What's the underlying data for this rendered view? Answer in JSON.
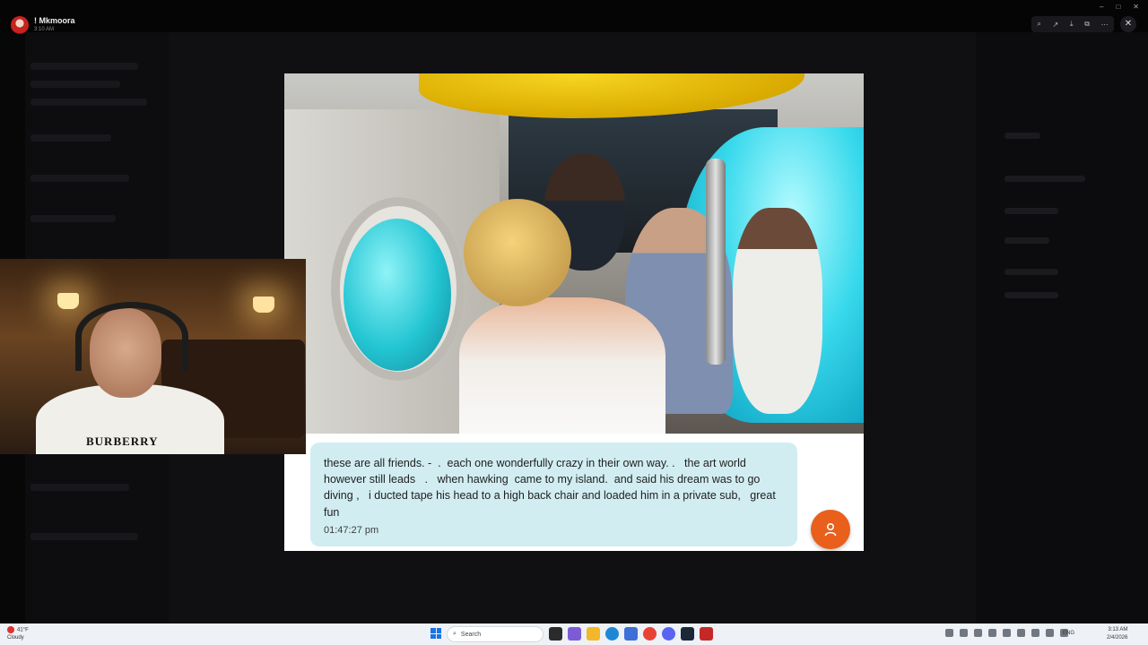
{
  "viewer": {
    "user_name": "! Mkmoora",
    "time": "3:10 AM"
  },
  "window_controls": [
    "–",
    "□",
    "✕"
  ],
  "viewer_tools": [
    "zoom-icon",
    "share-icon",
    "download-icon",
    "open-icon",
    "more-icon"
  ],
  "message": {
    "text": "these are all friends. -  .  each one wonderfully crazy in their own way. .   the art world however still leads   .   when hawking  came to my island.  and said his dream was to go diving ,   i ducted tape his head to a high back chair and loaded him in a private sub,   great fun",
    "timestamp": "01:47:27 pm"
  },
  "webcam": {
    "shirt_logo": "BURBERRY"
  },
  "taskbar": {
    "weather_temp": "41°F",
    "weather_desc": "Cloudy",
    "search_placeholder": "Search",
    "language": "ENG",
    "clock_time": "3:13 AM",
    "clock_date": "2/4/2026"
  },
  "colors": {
    "bubble": "#d1edf2",
    "fab": "#e8601c",
    "taskbar": "#eef1f5"
  }
}
